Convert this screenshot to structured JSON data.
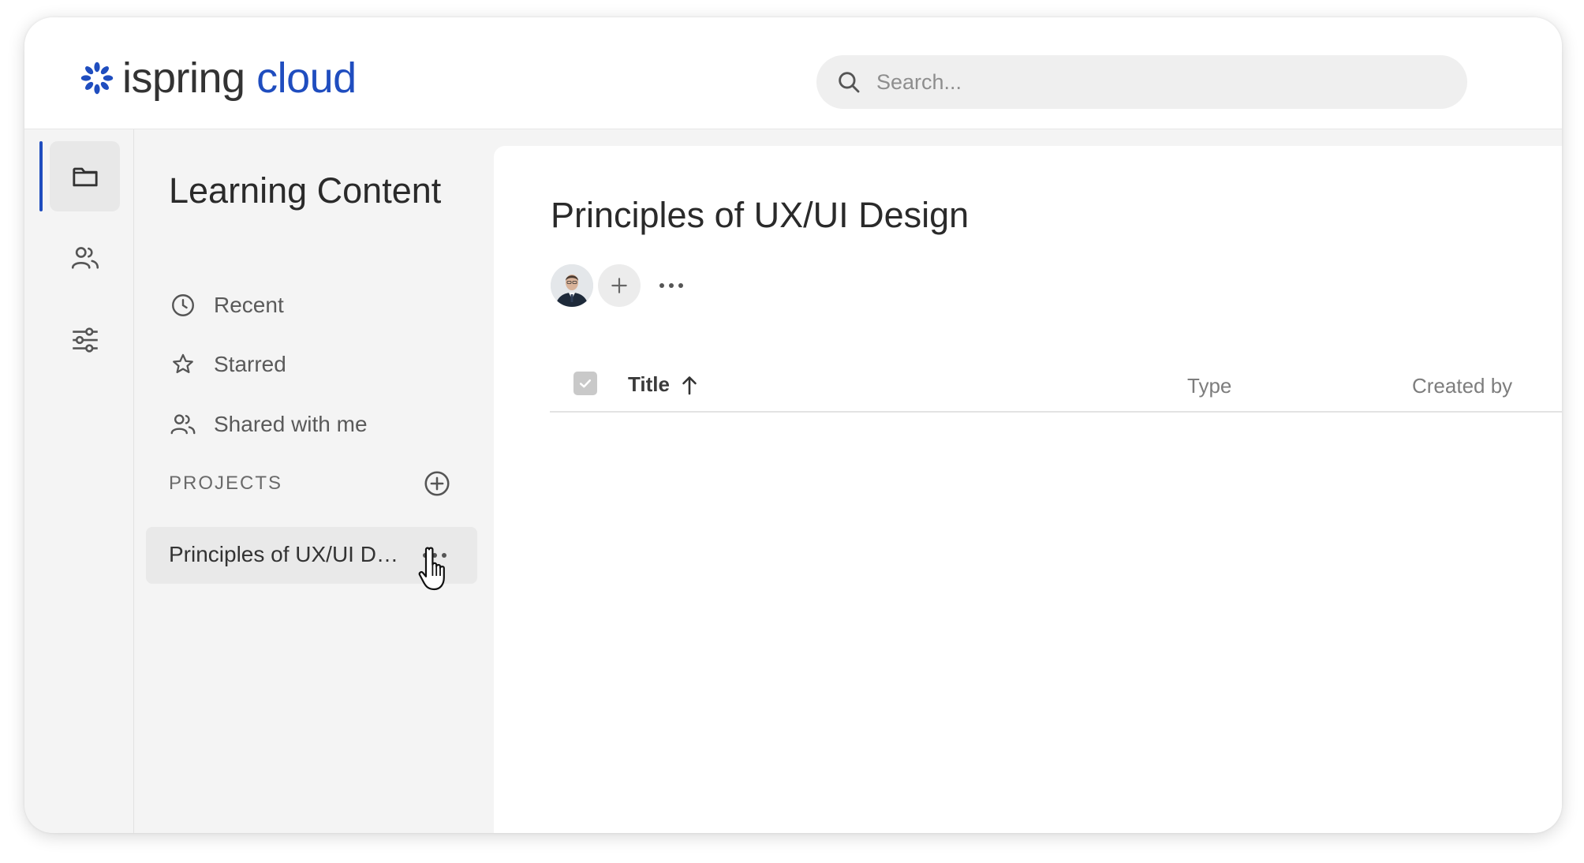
{
  "header": {
    "logo": {
      "part1": "ispring",
      "part2": "cloud",
      "icon": "ispring-asterisk-logo-icon"
    },
    "search": {
      "placeholder": "Search...",
      "value": "",
      "icon": "search-icon"
    }
  },
  "rail": {
    "items": [
      {
        "name": "content",
        "icon": "folder-icon",
        "active": true
      },
      {
        "name": "users",
        "icon": "users-icon",
        "active": false
      },
      {
        "name": "settings",
        "icon": "sliders-icon",
        "active": false
      }
    ]
  },
  "sidebar": {
    "title": "Learning Content",
    "nav": [
      {
        "label": "Recent",
        "icon": "clock-icon"
      },
      {
        "label": "Starred",
        "icon": "star-icon"
      },
      {
        "label": "Shared with me",
        "icon": "shared-users-icon"
      }
    ],
    "projects_label": "PROJECTS",
    "projects": [
      {
        "label": "Principles of UX/UI Design",
        "selected": true
      }
    ]
  },
  "main": {
    "title": "Principles of UX/UI Design",
    "table": {
      "columns": {
        "title": "Title",
        "type": "Type",
        "created_by": "Created by"
      },
      "sort": {
        "column": "title",
        "direction": "ascending"
      },
      "rows": []
    }
  },
  "colors": {
    "brand_blue": "#1f4dbf",
    "text_dark": "#2a2a2a",
    "panel_bg": "#f4f4f4",
    "content_bg": "#ffffff"
  }
}
